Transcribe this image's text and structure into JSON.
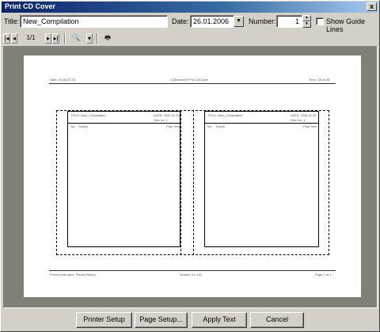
{
  "window": {
    "title": "Print CD Cover",
    "close_glyph": "x"
  },
  "form": {
    "title_label": "Title:",
    "title_value": "New_Compilation",
    "date_label": "Date:",
    "date_value": "26.01.2006",
    "date_dropdown_glyph": "▼",
    "number_label": "Number:",
    "number_value": "1",
    "spin_up_glyph": "▲",
    "spin_down_glyph": "▼",
    "show_guide_lines_label": "Show Guide Lines",
    "show_guide_lines_checked": false
  },
  "toolbar": {
    "first_glyph": "|◂",
    "prev_glyph": "◂",
    "page_indicator": "1/1",
    "next_glyph": "▸",
    "last_glyph": "▸|",
    "zoom_glyph": "🔍",
    "zoom_dropdown_glyph": "▾",
    "print_glyph": "🖶"
  },
  "paper": {
    "header_left": "Date: 29.08.07.26",
    "header_center": "CDBurnerXP Pro CDCover",
    "header_right": "Time: 13:16:38",
    "footer_left": "Printed with label, Please Return",
    "footer_center": "Version 3.0.116",
    "footer_right": "Page 1 of 1",
    "left_insert": {
      "title": "TITLE: New_Compilation",
      "date": "DATE: 2006.01.26",
      "disc": "Disc no: 1",
      "col_no": "No.",
      "col_track": "Tracks",
      "col_time": "Play Time"
    },
    "right_insert": {
      "title": "TITLE: New_Compilation",
      "date": "DATE: 2006.01.26",
      "disc": "Disc No: 1",
      "col_no": "No.",
      "col_track": "Tracks",
      "col_time": "Play Time"
    }
  },
  "buttons": {
    "printer_setup": "Printer Setup",
    "page_setup": "Page Setup...",
    "apply_text": "Apply Text",
    "cancel": "Cancel"
  }
}
